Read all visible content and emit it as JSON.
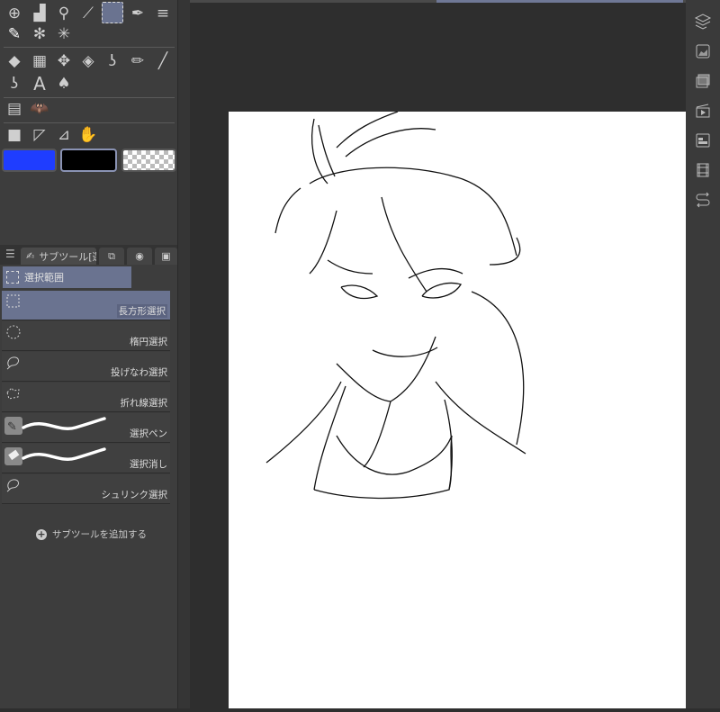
{
  "colors": {
    "main": "#1f3dff",
    "sub": "#000000",
    "accent": "#6a7390"
  },
  "tools": [
    "object",
    "fill-ink",
    "zoom",
    "eyedropper",
    "selection",
    "pen",
    "speed-lines",
    "pen-nib",
    "auto-select",
    "sparkle",
    "eraser",
    "grid",
    "move",
    "fill",
    "lasso-fill",
    "pencil",
    "line",
    "lasso-fill-2",
    "text",
    "blend",
    "layout",
    "bat",
    "gradient",
    "ruler",
    "ruler-pen",
    "hand"
  ],
  "subtool_panel": {
    "tab_label": "サブツール[選",
    "group_label": "選択範囲",
    "items": [
      {
        "label": "長方形選択",
        "selected": true
      },
      {
        "label": "楕円選択"
      },
      {
        "label": "投げなわ選択"
      },
      {
        "label": "折れ線選択"
      },
      {
        "label": "選択ペン"
      },
      {
        "label": "選択消し"
      },
      {
        "label": "シュリンク選択"
      }
    ],
    "add_label": "サブツールを追加する"
  }
}
